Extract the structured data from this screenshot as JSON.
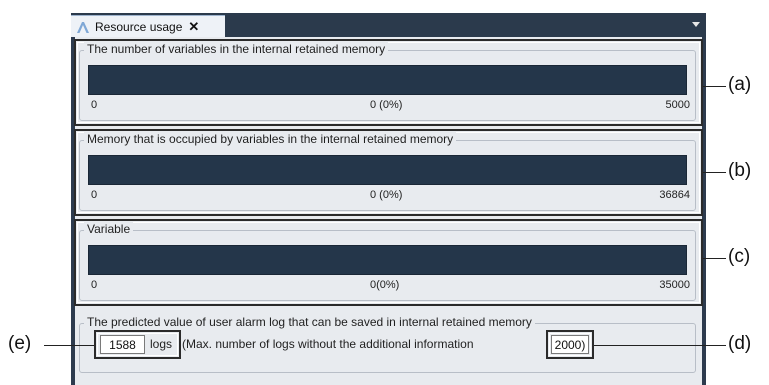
{
  "tab": {
    "title": "Resource usage",
    "close": "✕",
    "icon": "app-logo-icon"
  },
  "sections": [
    {
      "title": "The number of variables in the internal retained memory",
      "min": "0",
      "center": "0 (0%)",
      "max": "5000",
      "fill": 0
    },
    {
      "title": "Memory that is occupied by variables in the internal retained memory",
      "min": "0",
      "center": "0 (0%)",
      "max": "36864",
      "fill": 0
    },
    {
      "title": "Variable",
      "min": "0",
      "center": "0(0%)",
      "max": "35000",
      "fill": 0
    }
  ],
  "alarm": {
    "title": "The predicted value of user alarm log that can be saved in internal retained memory",
    "value": "1588",
    "unit": "logs",
    "desc": "(Max. number of logs without the additional information",
    "max": "2000)"
  },
  "callouts": {
    "a": "(a)",
    "b": "(b)",
    "c": "(c)",
    "d": "(d)",
    "e": "(e)"
  }
}
